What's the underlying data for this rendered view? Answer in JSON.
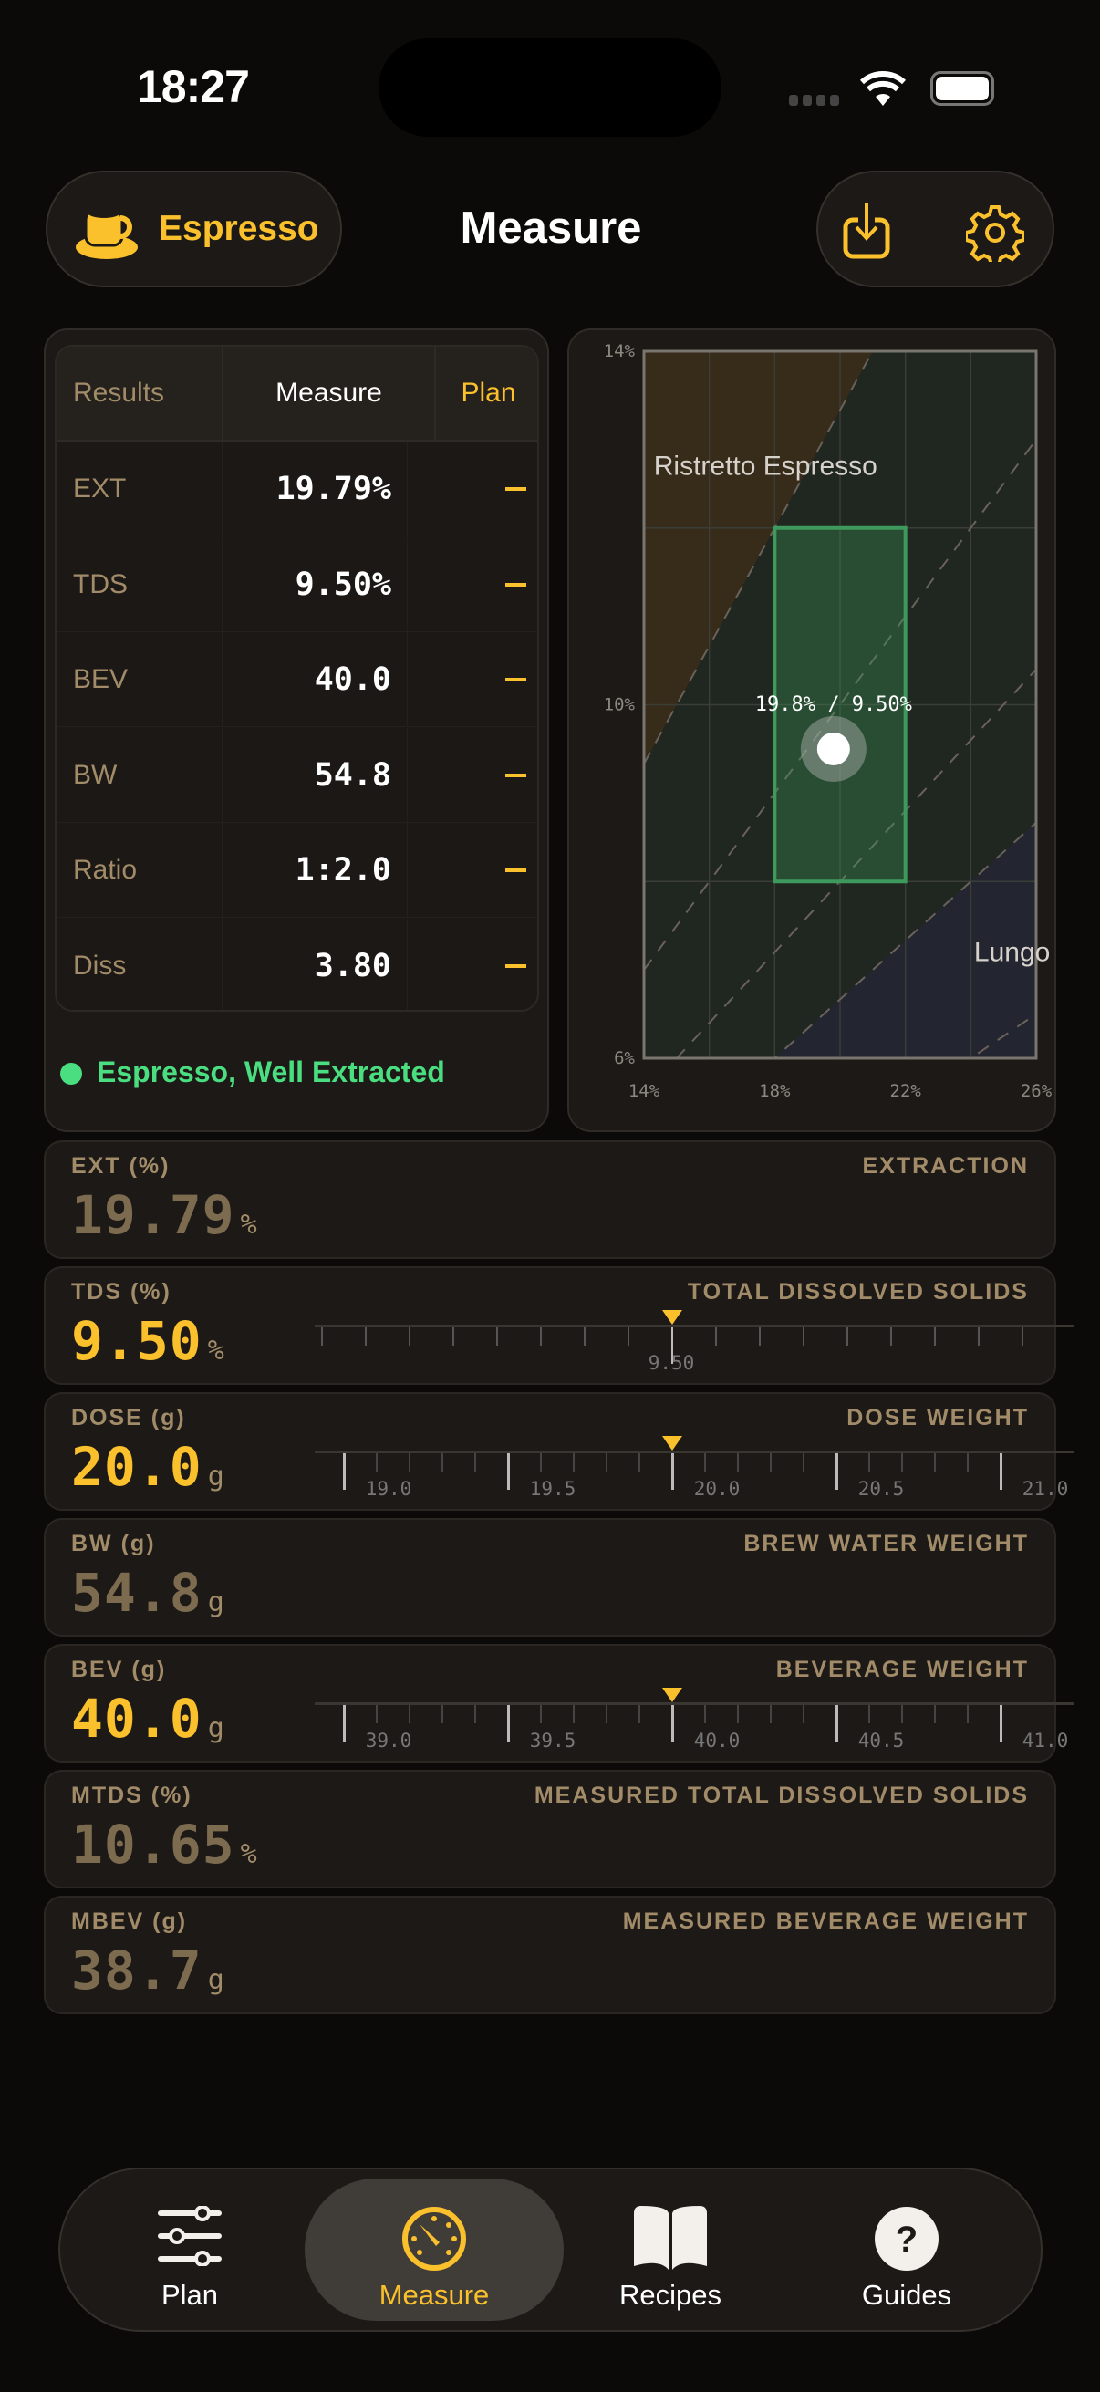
{
  "status_bar": {
    "time": "18:27"
  },
  "header": {
    "brew_method": "Espresso",
    "title": "Measure",
    "brew_icon": "coffee-cup-icon",
    "export_icon": "export-icon",
    "settings_icon": "gear-icon"
  },
  "results_table": {
    "headers": [
      "Results",
      "Measure",
      "Plan"
    ],
    "rows": [
      {
        "label": "EXT",
        "measure": "19.79%",
        "plan": "—"
      },
      {
        "label": "TDS",
        "measure": "9.50%",
        "plan": "—"
      },
      {
        "label": "BEV",
        "measure": "40.0",
        "plan": "—"
      },
      {
        "label": "BW",
        "measure": "54.8",
        "plan": "—"
      },
      {
        "label": "Ratio",
        "measure": "1:2.0",
        "plan": "—"
      },
      {
        "label": "Diss",
        "measure": "3.80",
        "plan": "—"
      }
    ],
    "status": "Espresso, Well Extracted",
    "status_color": "#4ade80"
  },
  "chart_data": {
    "type": "scatter",
    "xlim": [
      14,
      26
    ],
    "ylim": [
      6,
      14
    ],
    "x_ticks": [
      "14%",
      "18%",
      "22%",
      "26%"
    ],
    "y_ticks": [
      "14%",
      "10%",
      "6%"
    ],
    "grid": true,
    "ideal_box": {
      "x": [
        18,
        22
      ],
      "y": [
        8,
        12
      ]
    },
    "point": {
      "x": 19.8,
      "y": 9.5,
      "label": "19.8% / 9.50%"
    },
    "ratio_lines": [
      1.5,
      2,
      2.5,
      3,
      4
    ],
    "regions": [
      {
        "name": "Ristretto",
        "label": "Ristretto Espresso",
        "ratio_max": 1.5,
        "color": "#372b1a"
      },
      {
        "name": "Lungo",
        "label": "Lungo",
        "ratio_min": 3,
        "color": "#232630"
      }
    ]
  },
  "cards": [
    {
      "label": "EXT (%)",
      "desc": "EXTRACTION",
      "value": "19.79",
      "unit": "%",
      "editable": false
    },
    {
      "label": "TDS (%)",
      "desc": "TOTAL DISSOLVED SOLIDS",
      "value": "9.50",
      "unit": "%",
      "editable": true,
      "slider": {
        "labels": [
          "9.50"
        ]
      }
    },
    {
      "label": "DOSE (g)",
      "desc": "DOSE WEIGHT",
      "value": "20.0",
      "unit": "g",
      "editable": true,
      "slider": {
        "labels": [
          "19.0",
          "19.5",
          "20.0",
          "20.5",
          "21.0"
        ]
      }
    },
    {
      "label": "BW (g)",
      "desc": "BREW WATER WEIGHT",
      "value": "54.8",
      "unit": "g",
      "editable": false
    },
    {
      "label": "BEV (g)",
      "desc": "BEVERAGE WEIGHT",
      "value": "40.0",
      "unit": "g",
      "editable": true,
      "slider": {
        "labels": [
          "39.0",
          "39.5",
          "40.0",
          "40.5",
          "41.0"
        ]
      }
    },
    {
      "label": "MTDS (%)",
      "desc": "MEASURED TOTAL DISSOLVED SOLIDS",
      "value": "10.65",
      "unit": "%",
      "editable": false
    },
    {
      "label": "MBEV (g)",
      "desc": "MEASURED BEVERAGE WEIGHT",
      "value": "38.7",
      "unit": "g",
      "editable": false
    }
  ],
  "tabs": [
    {
      "label": "Plan",
      "icon": "sliders-icon",
      "active": false
    },
    {
      "label": "Measure",
      "icon": "gauge-icon",
      "active": true
    },
    {
      "label": "Recipes",
      "icon": "book-icon",
      "active": false
    },
    {
      "label": "Guides",
      "icon": "question-circle-icon",
      "active": false
    }
  ],
  "colors": {
    "accent": "#fbc12d",
    "muted": "#a18b68",
    "good": "#4ade80"
  }
}
